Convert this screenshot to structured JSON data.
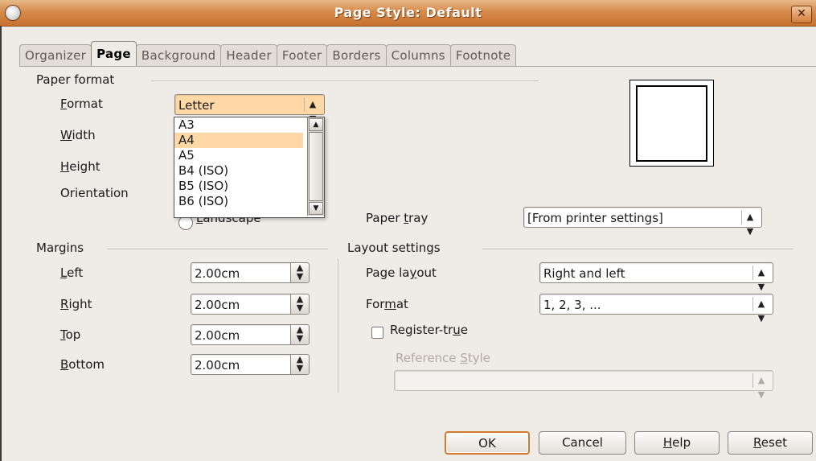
{
  "window": {
    "title": "Page Style: Default",
    "close_label": "✕"
  },
  "tabs": [
    {
      "label": "Organizer",
      "active": false
    },
    {
      "label": "Page",
      "active": true
    },
    {
      "label": "Background",
      "active": false
    },
    {
      "label": "Header",
      "active": false
    },
    {
      "label": "Footer",
      "active": false
    },
    {
      "label": "Borders",
      "active": false
    },
    {
      "label": "Columns",
      "active": false
    },
    {
      "label": "Footnote",
      "active": false
    }
  ],
  "paper_format": {
    "group_label": "Paper format",
    "format": {
      "label_pre": "",
      "label_u": "F",
      "label_post": "ormat",
      "value": "Letter"
    },
    "width": {
      "label_pre": "",
      "label_u": "W",
      "label_post": "idth"
    },
    "height": {
      "label_pre": "",
      "label_u": "H",
      "label_post": "eight"
    },
    "orientation_label": "Orientation",
    "landscape": {
      "label_pre": "",
      "label_u": "L",
      "label_post": "andscape"
    },
    "paper_tray": {
      "label_pre": "Paper ",
      "label_u": "t",
      "label_post": "ray",
      "value": "[From printer settings]"
    },
    "dropdown_items": [
      {
        "label": "A3",
        "highlighted": false
      },
      {
        "label": "A4",
        "highlighted": true
      },
      {
        "label": "A5",
        "highlighted": false
      },
      {
        "label": "B4 (ISO)",
        "highlighted": false
      },
      {
        "label": "B5 (ISO)",
        "highlighted": false
      },
      {
        "label": "B6 (ISO)",
        "highlighted": false
      }
    ]
  },
  "margins": {
    "group_label": "Margins",
    "left": {
      "label_pre": "",
      "label_u": "L",
      "label_post": "eft",
      "value": "2.00cm"
    },
    "right": {
      "label_pre": "",
      "label_u": "R",
      "label_post": "ight",
      "value": "2.00cm"
    },
    "top": {
      "label_pre": "",
      "label_u": "T",
      "label_post": "op",
      "value": "2.00cm"
    },
    "bottom": {
      "label_pre": "",
      "label_u": "B",
      "label_post": "ottom",
      "value": "2.00cm"
    }
  },
  "layout": {
    "group_label": "Layout settings",
    "page_layout": {
      "label_pre": "Page la",
      "label_u": "y",
      "label_post": "out",
      "value": "Right and left"
    },
    "format": {
      "label_pre": "For",
      "label_u": "m",
      "label_post": "at",
      "value": "1, 2, 3, ..."
    },
    "register_true": {
      "label_pre": "Register-tr",
      "label_u": "u",
      "label_post": "e",
      "checked": false
    },
    "reference_style": {
      "label_pre": "Reference ",
      "label_u": "S",
      "label_post": "tyle",
      "value": ""
    }
  },
  "buttons": {
    "ok": "OK",
    "cancel": "Cancel",
    "help": {
      "pre": "",
      "u": "H",
      "post": "elp"
    },
    "reset": {
      "pre": "",
      "u": "R",
      "post": "eset"
    }
  },
  "colors": {
    "titlebar": "#d68a4a",
    "highlight": "#ffd8a6",
    "default_button_border": "#d47a2f"
  }
}
